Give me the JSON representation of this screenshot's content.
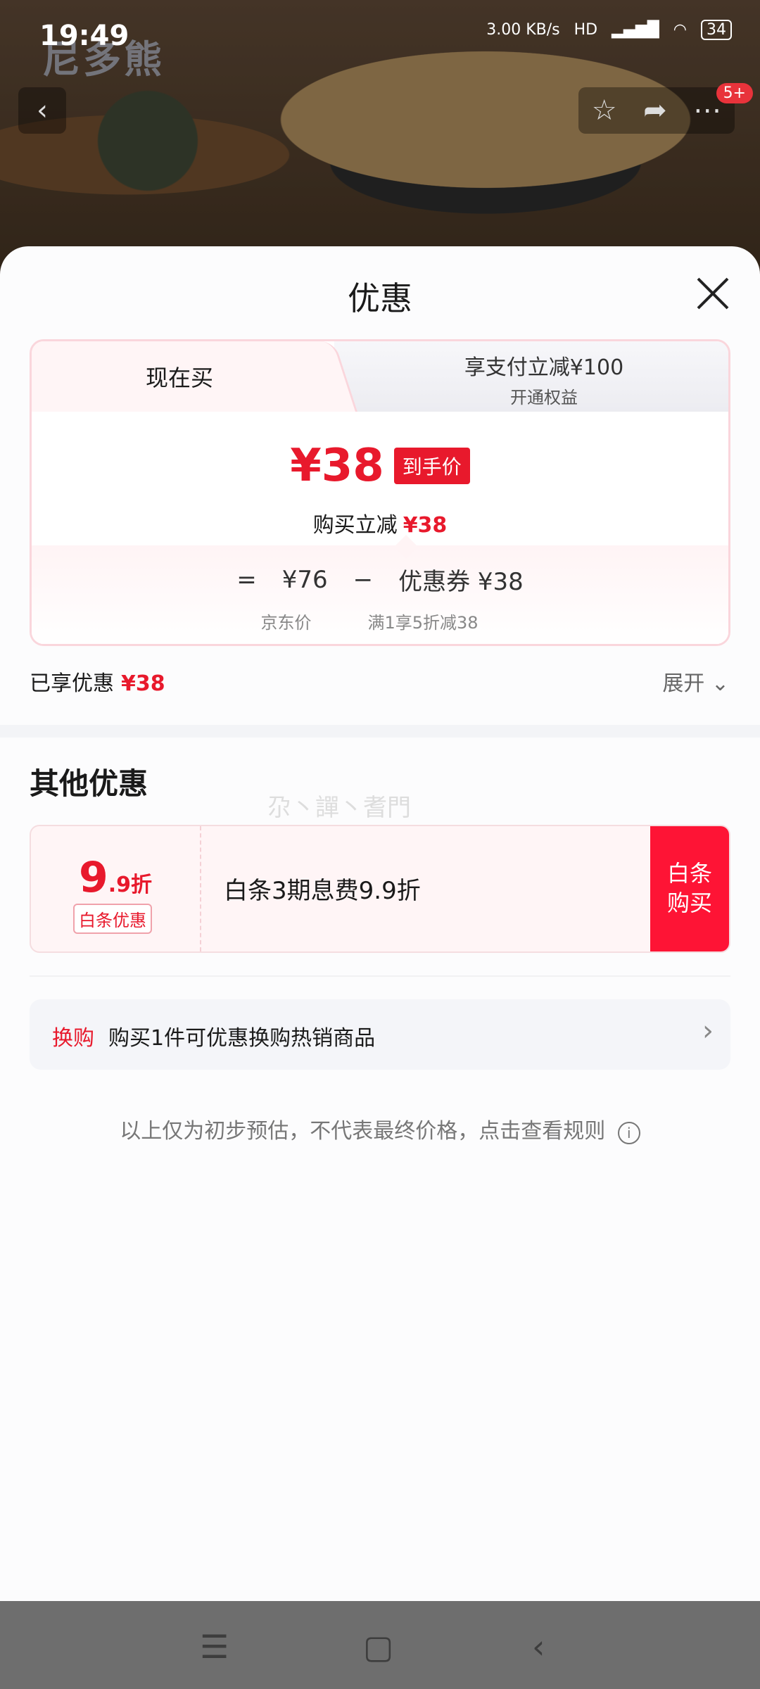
{
  "status_bar": {
    "time": "19:49",
    "net_speed": "3.00 KB/s",
    "net_type": "HD",
    "battery": "34"
  },
  "watermark": "尼多熊",
  "top_buttons": {
    "back_icon": "chevron-left-icon",
    "star_icon": "star-icon",
    "share_icon": "share-icon",
    "more_icon": "more-icon",
    "badge": "5+"
  },
  "sheet": {
    "title": "优惠"
  },
  "tabs": [
    {
      "label": "现在买",
      "selected": true
    },
    {
      "label": "享支付立减¥100",
      "sublabel": "开通权益",
      "selected": false
    }
  ],
  "price_block": {
    "final_price": "¥38",
    "price_tag": "到手价",
    "reduce_text": "购买立减",
    "reduce_value": "¥38",
    "formula": {
      "eq": "=",
      "jd_price": "¥76",
      "minus": "−",
      "coupon_label": "优惠券",
      "coupon_value": "¥38"
    },
    "formula_sub": {
      "jd_price_label": "京东价",
      "coupon_rule": "满1享5折减38"
    }
  },
  "enjoyed": {
    "label": "已享优惠",
    "value": "¥38",
    "expand": "展开"
  },
  "other": {
    "title": "其他优惠",
    "faint_text": "尕丶譂丶耆門",
    "coupon": {
      "value_big": "9",
      "value_small": ".9折",
      "tag": "白条优惠",
      "desc": "白条3期息费9.9折",
      "button": "白条购买"
    }
  },
  "swap": {
    "label": "换购",
    "text": "购买1件可优惠换购热销商品"
  },
  "disclaimer": "以上仅为初步预估，不代表最终价格，点击查看规则",
  "colors": {
    "accent": "#e8192c",
    "button_red": "#fe1435"
  }
}
